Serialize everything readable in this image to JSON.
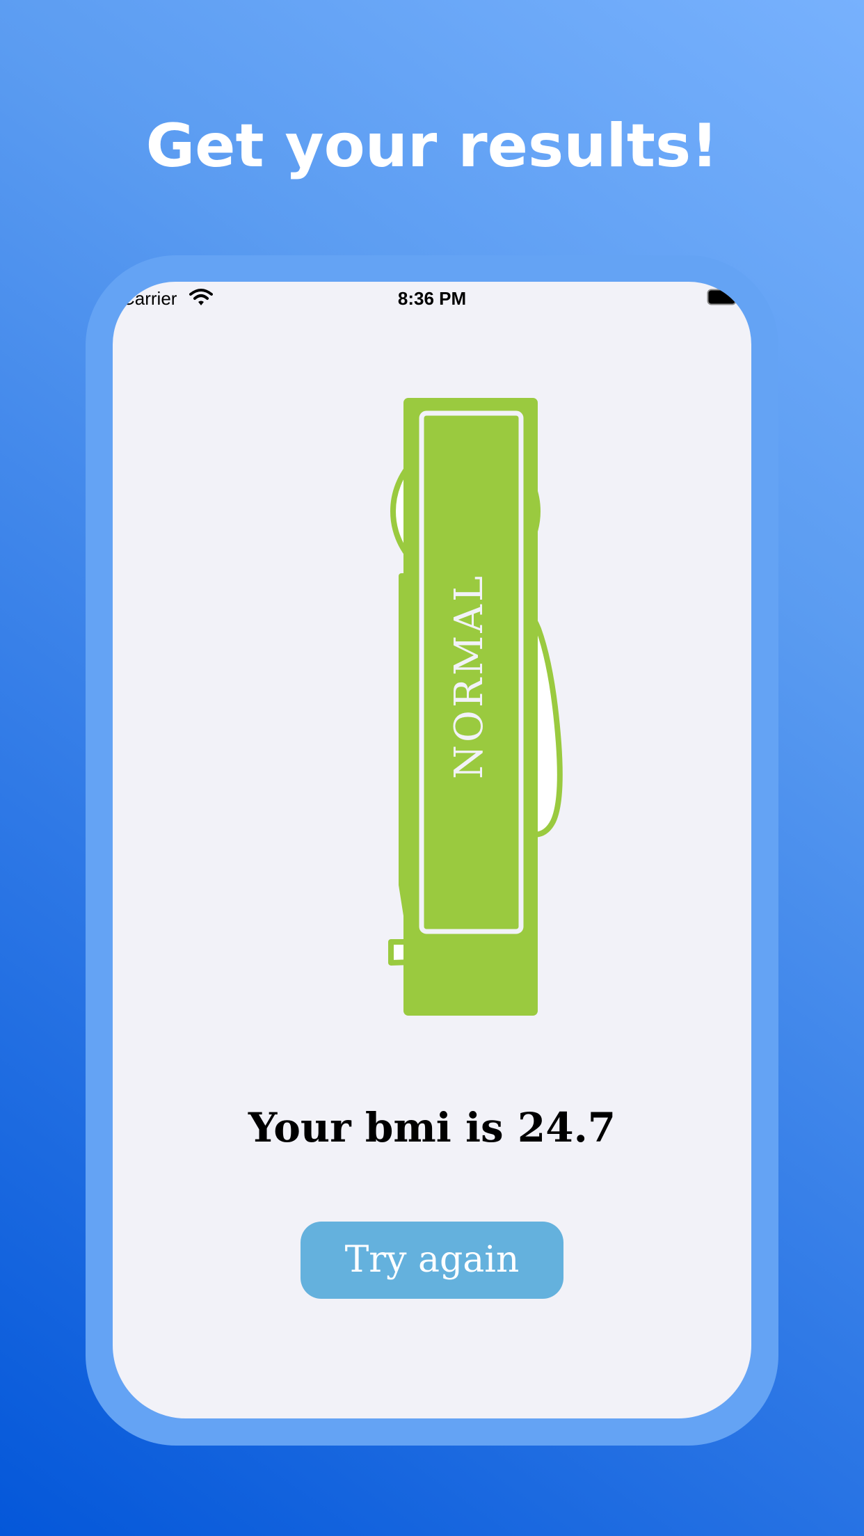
{
  "header": {
    "title": "Get your results!"
  },
  "status_bar": {
    "carrier": "Carrier",
    "time": "8:36 PM"
  },
  "result": {
    "category": "NORMAL",
    "bmi_text": "Your bmi is 24.7"
  },
  "actions": {
    "try_again_label": "Try again"
  },
  "colors": {
    "category_green": "#9aca3f",
    "button_blue": "#64b1dd",
    "frame_blue": "#64a3f4"
  },
  "icons": {
    "wifi": "wifi-icon",
    "battery": "battery-icon"
  }
}
